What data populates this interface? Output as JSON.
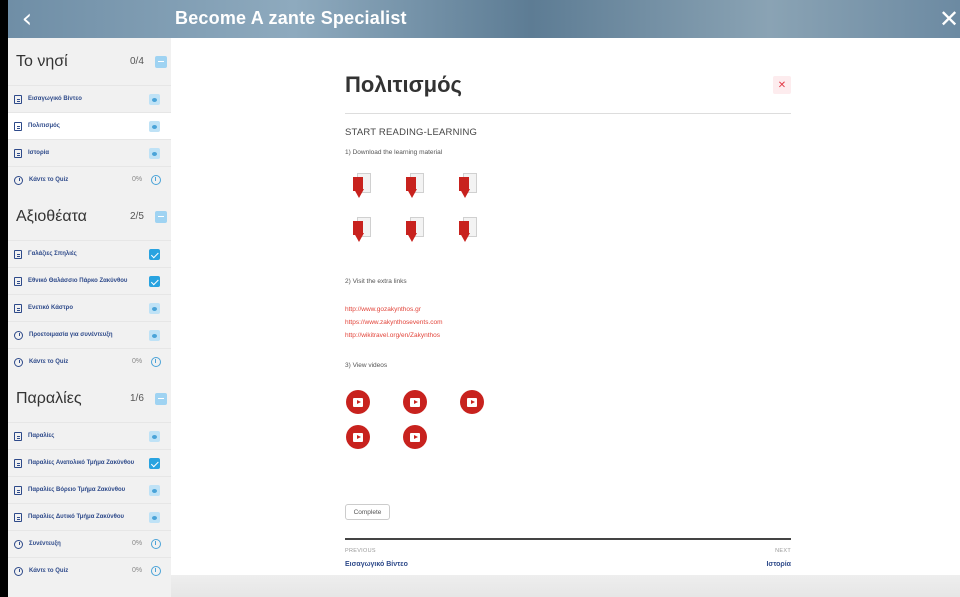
{
  "header": {
    "back_icon": "‹",
    "title": "Become A zante Specialist",
    "close_icon": "✕"
  },
  "sidebar": {
    "sections": [
      {
        "title": "Το νησί",
        "count": "0/4",
        "items": [
          {
            "label": "Εισαγωγικό Βίντεο",
            "icon": "document-icon",
            "status": "viewed"
          },
          {
            "label": "Πολιτισμός",
            "icon": "document-icon",
            "status": "viewed",
            "active": true
          },
          {
            "label": "Ιστορία",
            "icon": "document-icon",
            "status": "viewed"
          },
          {
            "label": "Κάντε το Quiz",
            "icon": "clock-icon",
            "status": "0%"
          }
        ]
      },
      {
        "title": "Αξιοθέατα",
        "count": "2/5",
        "items": [
          {
            "label": "Γαλάζιες Σπηλιές",
            "icon": "document-icon",
            "status": "complete"
          },
          {
            "label": "Εθνικό Θαλάσσιο Πάρκο Ζακύνθου",
            "icon": "document-icon",
            "status": "complete"
          },
          {
            "label": "Ενετικό Κάστρο",
            "icon": "document-icon",
            "status": "viewed"
          },
          {
            "label": "Προετοιμασία για συνέντευξη",
            "icon": "clock-icon",
            "status": "viewed"
          },
          {
            "label": "Κάντε το Quiz",
            "icon": "clock-icon",
            "status": "0%"
          }
        ]
      },
      {
        "title": "Παραλίες",
        "count": "1/6",
        "items": [
          {
            "label": "Παραλίες",
            "icon": "document-icon",
            "status": "viewed"
          },
          {
            "label": "Παραλίες Ανατολικό Τμήμα Ζακύνθου",
            "icon": "document-icon",
            "status": "complete"
          },
          {
            "label": "Παραλίες Βόρειο Τμήμα Ζακύνθου",
            "icon": "document-icon",
            "status": "viewed"
          },
          {
            "label": "Παραλίες Δυτικό Τμήμα Ζακύνθου",
            "icon": "document-icon",
            "status": "viewed"
          },
          {
            "label": "Συνέντευξη",
            "icon": "clock-icon",
            "status": "0%"
          },
          {
            "label": "Κάντε το Quiz",
            "icon": "clock-icon",
            "status": "0%"
          }
        ]
      }
    ]
  },
  "main": {
    "title": "Πολιτισμός",
    "close_icon": "✕",
    "start_heading": "START READING-LEARNING",
    "step1": "1) Download the learning material",
    "pdf_count": 6,
    "step2": "2) Visit the extra links",
    "links": [
      "http://www.gozakynthos.gr",
      "https://www.zakynthosevents.com",
      "http://wikitravel.org/en/Zakynthos"
    ],
    "step3": "3) View videos",
    "video_count": 5,
    "complete_label": "Complete",
    "nav": {
      "previous_caption": "PREVIOUS",
      "previous_label": "Εισαγωγικό Βίντεο",
      "next_caption": "NEXT",
      "next_label": "Ιστορία"
    }
  }
}
